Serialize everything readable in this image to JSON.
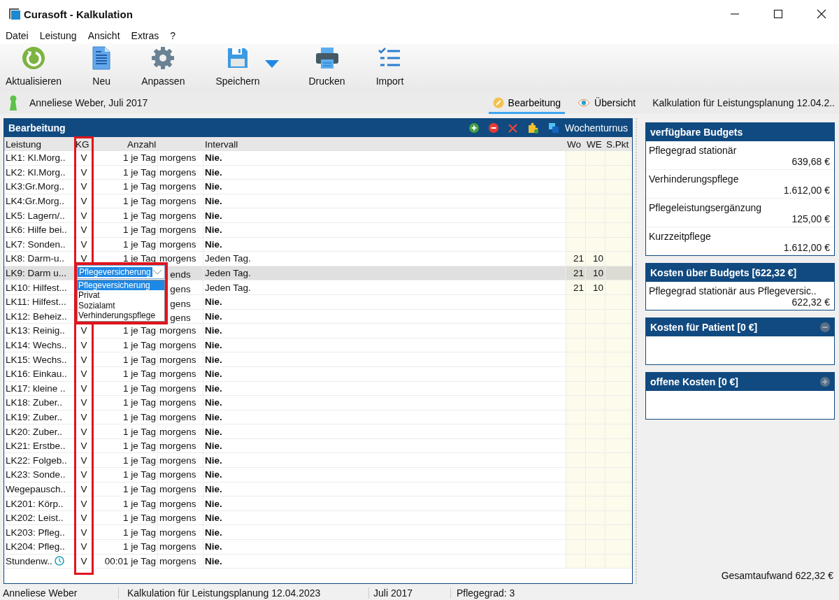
{
  "window": {
    "title": "Curasoft - Kalkulation"
  },
  "menu": [
    "Datei",
    "Leistung",
    "Ansicht",
    "Extras",
    "?"
  ],
  "toolbar": [
    {
      "kind": "refresh",
      "label": "Aktualisieren"
    },
    {
      "kind": "new",
      "label": "Neu"
    },
    {
      "kind": "settings",
      "label": "Anpassen"
    },
    {
      "kind": "save",
      "label": "Speichern",
      "dropdown": true
    },
    {
      "kind": "print",
      "label": "Drucken"
    },
    {
      "kind": "import",
      "label": "Import"
    }
  ],
  "patient": "Anneliese Weber, Juli 2017",
  "tabs": [
    {
      "kind": "edit",
      "label": "Bearbeitung",
      "selected": true
    },
    {
      "kind": "view",
      "label": "Übersicht",
      "selected": false
    }
  ],
  "document_title": "Kalkulation für Leistungsplanung 12.04.2..",
  "editor_panel": {
    "title": "Bearbeitung",
    "turnus_label": "Wochenturnus",
    "columns": [
      "Leistung",
      "KG",
      "Anzahl",
      "Intervall",
      "Wo",
      "WE",
      "S.Pkt"
    ],
    "rows": [
      {
        "leistung": "LK1: Kl.Morg..",
        "kg": "V",
        "anzahl": "1 je Tag",
        "zeit": "morgens",
        "intervall": "Nie.",
        "emphasized": true,
        "selected": false
      },
      {
        "leistung": "LK2: Kl.Morg..",
        "kg": "V",
        "anzahl": "1 je Tag",
        "zeit": "morgens",
        "intervall": "Nie.",
        "emphasized": true,
        "selected": false
      },
      {
        "leistung": "LK3:Gr.Morg..",
        "kg": "V",
        "anzahl": "1 je Tag",
        "zeit": "morgens",
        "intervall": "Nie.",
        "emphasized": true,
        "selected": false
      },
      {
        "leistung": "LK4:Gr.Morg..",
        "kg": "V",
        "anzahl": "1 je Tag",
        "zeit": "morgens",
        "intervall": "Nie.",
        "emphasized": true,
        "selected": false
      },
      {
        "leistung": "LK5: Lagern/..",
        "kg": "V",
        "anzahl": "1 je Tag",
        "zeit": "morgens",
        "intervall": "Nie.",
        "emphasized": true,
        "selected": false
      },
      {
        "leistung": "LK6: Hilfe bei..",
        "kg": "V",
        "anzahl": "1 je Tag",
        "zeit": "morgens",
        "intervall": "Nie.",
        "emphasized": true,
        "selected": false
      },
      {
        "leistung": "LK7: Sonden..",
        "kg": "V",
        "anzahl": "1 je Tag",
        "zeit": "morgens",
        "intervall": "Nie.",
        "emphasized": true,
        "selected": false
      },
      {
        "leistung": "LK8: Darm-u..",
        "kg": "V",
        "anzahl": "1 je Tag",
        "zeit": "morgens",
        "intervall": "Jeden Tag.",
        "emphasized": false,
        "wo": "21",
        "we": "10",
        "selected": false
      },
      {
        "leistung": "LK9: Darm u...",
        "zeit": "ends",
        "intervall": "Jeden Tag.",
        "emphasized": false,
        "wo": "21",
        "we": "10",
        "selected": true,
        "editor": {
          "value": "Pflegeversicherung",
          "options": [
            {
              "label": "Pflegeversicherung",
              "selected": true
            },
            {
              "label": "Privat",
              "selected": false
            },
            {
              "label": "Sozialamt",
              "selected": false
            },
            {
              "label": "Verhinderungspflege",
              "selected": false
            }
          ]
        }
      },
      {
        "leistung": "LK10: Hilfest...",
        "zeit": "gens",
        "intervall": "Jeden Tag.",
        "emphasized": false,
        "wo": "21",
        "we": "10",
        "selected": false
      },
      {
        "leistung": "LK11: Hilfest...",
        "zeit": "gens",
        "intervall": "Nie.",
        "emphasized": true,
        "selected": false
      },
      {
        "leistung": "LK12: Beheiz..",
        "zeit": "gens",
        "intervall": "Nie.",
        "emphasized": true,
        "selected": false
      },
      {
        "leistung": "LK13: Reinig..",
        "kg": "V",
        "anzahl": "1 je Tag",
        "zeit": "morgens",
        "intervall": "Nie.",
        "emphasized": true,
        "selected": false
      },
      {
        "leistung": "LK14: Wechs..",
        "kg": "V",
        "anzahl": "1 je Tag",
        "zeit": "morgens",
        "intervall": "Nie.",
        "emphasized": true,
        "selected": false
      },
      {
        "leistung": "LK15: Wechs..",
        "kg": "V",
        "anzahl": "1 je Tag",
        "zeit": "morgens",
        "intervall": "Nie.",
        "emphasized": true,
        "selected": false
      },
      {
        "leistung": "LK16: Einkau..",
        "kg": "V",
        "anzahl": "1 je Tag",
        "zeit": "morgens",
        "intervall": "Nie.",
        "emphasized": true,
        "selected": false
      },
      {
        "leistung": "LK17: kleine ..",
        "kg": "V",
        "anzahl": "1 je Tag",
        "zeit": "morgens",
        "intervall": "Nie.",
        "emphasized": true,
        "selected": false
      },
      {
        "leistung": "LK18: Zuber..",
        "kg": "V",
        "anzahl": "1 je Tag",
        "zeit": "morgens",
        "intervall": "Nie.",
        "emphasized": true,
        "selected": false
      },
      {
        "leistung": "LK19: Zuber..",
        "kg": "V",
        "anzahl": "1 je Tag",
        "zeit": "morgens",
        "intervall": "Nie.",
        "emphasized": true,
        "selected": false
      },
      {
        "leistung": "LK20: Zuber..",
        "kg": "V",
        "anzahl": "1 je Tag",
        "zeit": "morgens",
        "intervall": "Nie.",
        "emphasized": true,
        "selected": false
      },
      {
        "leistung": "LK21: Erstbe..",
        "kg": "V",
        "anzahl": "1 je Tag",
        "zeit": "morgens",
        "intervall": "Nie.",
        "emphasized": true,
        "selected": false
      },
      {
        "leistung": "LK22: Folgeb..",
        "kg": "V",
        "anzahl": "1 je Tag",
        "zeit": "morgens",
        "intervall": "Nie.",
        "emphasized": true,
        "selected": false
      },
      {
        "leistung": "LK23: Sonde..",
        "kg": "V",
        "anzahl": "1 je Tag",
        "zeit": "morgens",
        "intervall": "Nie.",
        "emphasized": true,
        "selected": false
      },
      {
        "leistung": "Wegepausch..",
        "kg": "V",
        "anzahl": "1 je Tag",
        "zeit": "morgens",
        "intervall": "Nie.",
        "emphasized": true,
        "selected": false
      },
      {
        "leistung": "LK201: Körp..",
        "kg": "V",
        "anzahl": "1 je Tag",
        "zeit": "morgens",
        "intervall": "Nie.",
        "emphasized": true,
        "selected": false
      },
      {
        "leistung": "LK202: Leist..",
        "kg": "V",
        "anzahl": "1 je Tag",
        "zeit": "morgens",
        "intervall": "Nie.",
        "emphasized": true,
        "selected": false
      },
      {
        "leistung": "LK203: Pfleg..",
        "kg": "V",
        "anzahl": "1 je Tag",
        "zeit": "morgens",
        "intervall": "Nie.",
        "emphasized": true,
        "selected": false
      },
      {
        "leistung": "LK204: Pfleg..",
        "kg": "V",
        "anzahl": "1 je Tag",
        "zeit": "morgens",
        "intervall": "Nie.",
        "emphasized": true,
        "selected": false
      },
      {
        "leistung": "Stundenw..",
        "timed": true,
        "kg": "V",
        "anzahl": "00:01 je Tag",
        "zeit": "morgens",
        "intervall": "Nie.",
        "emphasized": true,
        "selected": false
      }
    ]
  },
  "budget_cards": [
    {
      "title": "verfügbare Budgets",
      "items": [
        {
          "label": "Pflegegrad stationär",
          "amount": "639,68 €"
        },
        {
          "label": "Verhinderungspflege",
          "amount": "1.612,00 €"
        },
        {
          "label": "Pflegeleistungsergänzung",
          "amount": "125,00 €"
        },
        {
          "label": "Kurzzeitpflege",
          "amount": "1.612,00 €"
        }
      ]
    },
    {
      "title": "Kosten über Budgets [622,32 €]",
      "items": [
        {
          "label": "Pflegegrad stationär aus Pflegeversic..",
          "amount": "622,32 €"
        }
      ]
    },
    {
      "title": "Kosten für Patient [0 €]",
      "expanded": true
    },
    {
      "title": "offene Kosten [0 €]",
      "expanded": false
    }
  ],
  "total": "Gesamtaufwand 622,32 €",
  "status_bar": [
    "Anneliese Weber",
    "Kalkulation für Leistungsplanung 12.04.2023",
    "Juli 2017",
    "Pflegegrad: 3"
  ]
}
